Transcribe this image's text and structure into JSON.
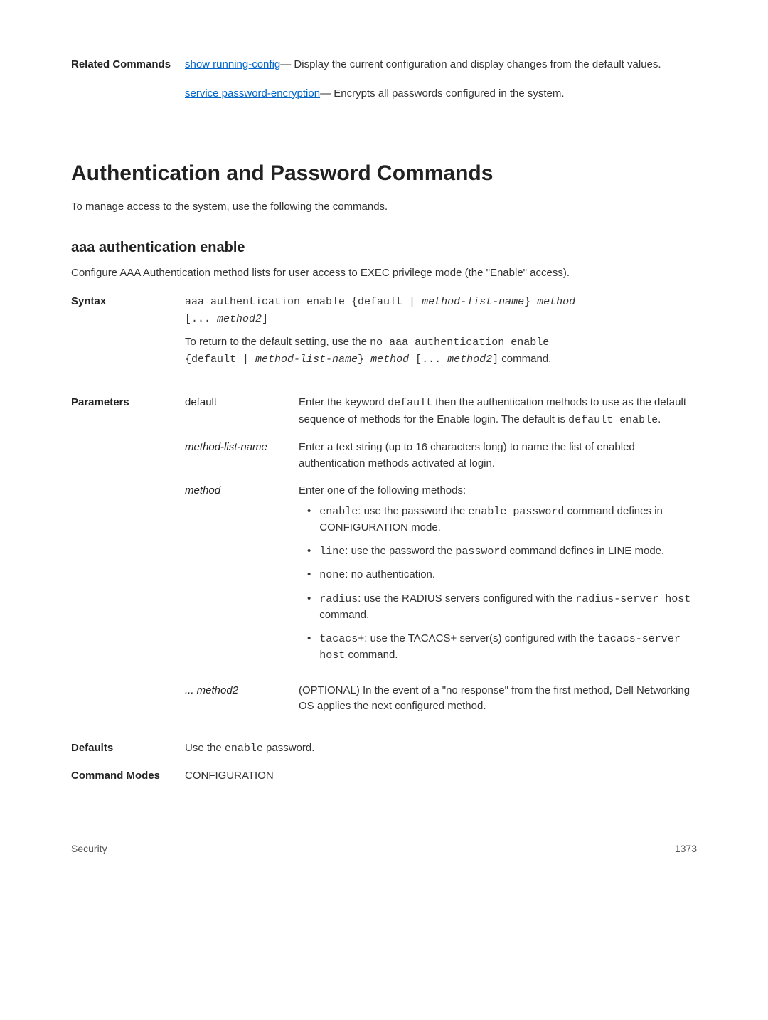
{
  "related": {
    "label": "Related Commands",
    "row1": {
      "link": "show running-config",
      "text": "— Display the current configuration and display changes from the default values."
    },
    "row2": {
      "link": "service password-encryption",
      "text": "— Encrypts all passwords configured in the system."
    }
  },
  "section": {
    "title": "Authentication and Password Commands",
    "intro": "To manage access to the system, use the following the commands."
  },
  "sub": {
    "title": "aaa authentication enable",
    "intro": "Configure AAA Authentication method lists for user access to EXEC privilege mode (the \"Enable\" access)."
  },
  "syntax": {
    "label": "Syntax",
    "line1a": "aaa authentication enable {default | ",
    "line1b": "method-list-name",
    "line1c": "} ",
    "line1d": "method",
    "line2a": "[... ",
    "line2b": "method2",
    "line2c": "]",
    "ret1": "To return to the default setting, use the ",
    "ret2": "no aaa authentication enable",
    "ret3a": "{default | ",
    "ret3b": "method-list-name",
    "ret3c": "} ",
    "ret3d": "method",
    "ret3e": " [... ",
    "ret3f": "method2",
    "ret3g": "]",
    "ret3h": " command."
  },
  "params": {
    "label": "Parameters",
    "default": {
      "name": "default",
      "d1": "Enter the keyword ",
      "d2": "default",
      "d3": " then the authentication methods to use as the default sequence of methods for the Enable login. The default is ",
      "d4": "default enable",
      "d5": "."
    },
    "mlname": {
      "name": "method-list-name",
      "desc": "Enter a text string (up to 16 characters long) to name the list of enabled authentication methods activated at login."
    },
    "method": {
      "name": "method",
      "intro": "Enter one of the following methods:",
      "b1a": "enable",
      "b1b": ": use the password the ",
      "b1c": "enable password",
      "b1d": " command defines in CONFIGURATION mode.",
      "b2a": "line",
      "b2b": ": use the password the ",
      "b2c": "password",
      "b2d": " command defines in LINE mode.",
      "b3a": "none",
      "b3b": ": no authentication.",
      "b4a": "radius",
      "b4b": ": use the RADIUS servers configured with the ",
      "b4c": "radius-server host",
      "b4d": " command.",
      "b5a": "tacacs+",
      "b5b": ": use the TACACS+ server(s) configured with the ",
      "b5c": "tacacs-server host",
      "b5d": " command."
    },
    "method2": {
      "name": "... method2",
      "desc": "(OPTIONAL) In the event of a \"no response\" from the first method, Dell Networking OS applies the next configured method."
    }
  },
  "defaults": {
    "label": "Defaults",
    "t1": "Use the ",
    "t2": "enable",
    "t3": " password."
  },
  "modes": {
    "label": "Command Modes",
    "value": "CONFIGURATION"
  },
  "footer": {
    "left": "Security",
    "right": "1373"
  }
}
